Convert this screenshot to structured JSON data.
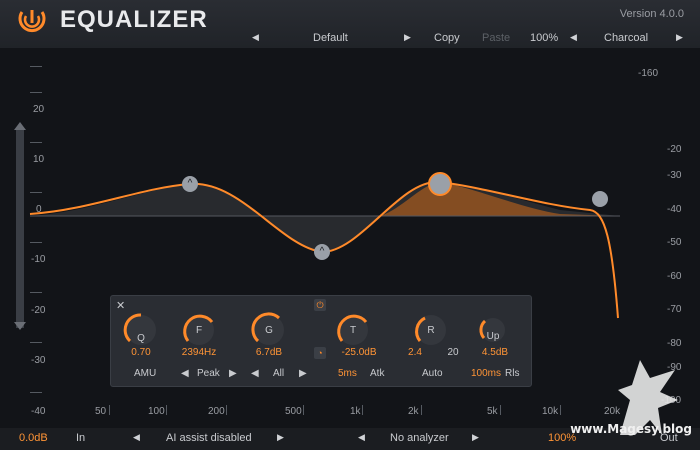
{
  "header": {
    "title": "EQUALIZER",
    "version": "Version 4.0.0"
  },
  "toolbar": {
    "preset": "Default",
    "copy": "Copy",
    "paste": "Paste",
    "zoom": "100%",
    "theme": "Charcoal"
  },
  "gain_scale": [
    "20",
    "10",
    "0",
    "-10",
    "-20",
    "-30",
    "-40"
  ],
  "analyzer_scale": [
    "-160",
    "-20",
    "-30",
    "-40",
    "-50",
    "-60",
    "-70",
    "-80",
    "-90",
    "-100"
  ],
  "freq_scale": [
    "50",
    "100",
    "200",
    "500",
    "1k",
    "2k",
    "5k",
    "10k",
    "20k"
  ],
  "panel": {
    "close": "✕",
    "q": {
      "label": "Q",
      "value": "0.70"
    },
    "f": {
      "label": "F",
      "value": "2394Hz"
    },
    "g": {
      "label": "G",
      "value": "6.7dB"
    },
    "t": {
      "label": "T",
      "value": "-25.0dB"
    },
    "r": {
      "label": "R",
      "value": "2.4",
      "max": "20"
    },
    "up": {
      "label": "Up",
      "value": "4.5dB"
    },
    "amu": "AMU",
    "shape": "Peak",
    "channel": "All",
    "attack_value": "5ms",
    "attack_label": "Atk",
    "auto": "Auto",
    "release_value": "100ms",
    "release_label": "Rls"
  },
  "footer": {
    "output": "0.0dB",
    "in": "In",
    "ai": "AI assist disabled",
    "analyzer": "No analyzer",
    "zoom": "100%",
    "out": "Out"
  },
  "watermark": "www.Magesy.blog",
  "colors": {
    "accent": "#ff8a2a",
    "node": "#9aa0a8",
    "bg": "#121418"
  },
  "icons": [
    "power-icon",
    "close-icon",
    "bypass-icon",
    "autogain-icon",
    "band-node-icon"
  ]
}
